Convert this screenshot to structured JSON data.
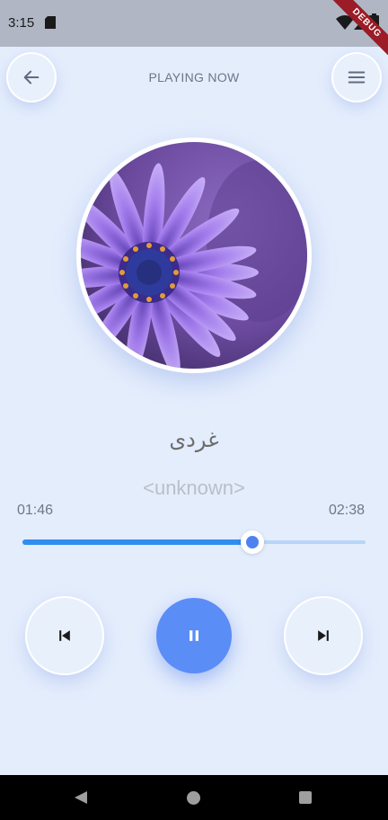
{
  "status_bar": {
    "time": "3:15"
  },
  "debug_banner": "DEBUG",
  "header": {
    "title": "PLAYING NOW"
  },
  "song": {
    "title": "غردی",
    "artist": "<unknown>"
  },
  "player": {
    "current_time": "01:46",
    "total_time": "02:38",
    "progress": 0.67,
    "state": "playing"
  },
  "colors": {
    "background": "#e4edfc",
    "accent": "#5b8df7",
    "slider_active": "#2f8ef0",
    "slider_inactive": "#b7d5f6"
  },
  "icons": {
    "back": "arrow-left-icon",
    "menu": "hamburger-menu-icon",
    "previous": "skip-previous-icon",
    "play_pause": "pause-icon",
    "next": "skip-next-icon"
  }
}
